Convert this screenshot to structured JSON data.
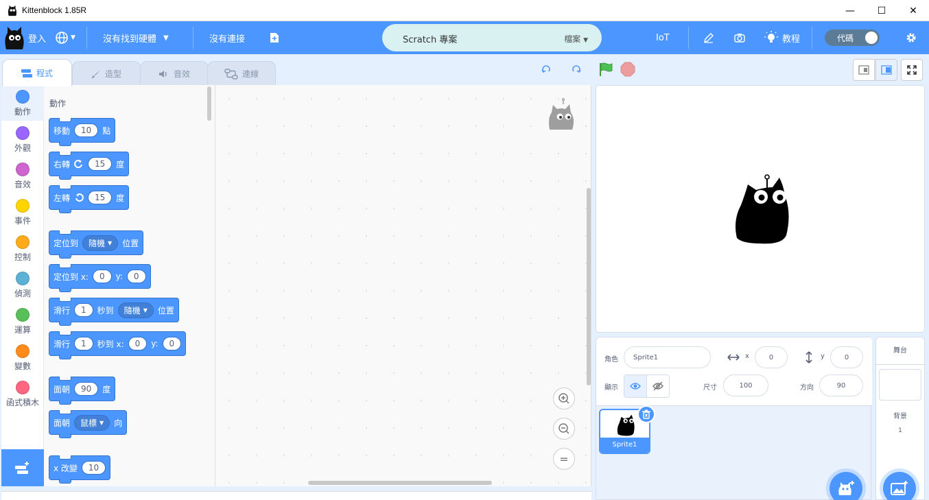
{
  "window": {
    "title": "Kittenblock 1.85R",
    "minimize": "—",
    "maximize": "☐",
    "close": "✕"
  },
  "menubar": {
    "login": "登入",
    "hardware": "沒有找到硬體",
    "connection": "沒有連接",
    "project_title": "Scratch 專案",
    "file_menu": "檔案",
    "iot": "IoT",
    "tutorials": "教程",
    "code_toggle": "代碼"
  },
  "tabs": [
    {
      "label": "程式"
    },
    {
      "label": "造型"
    },
    {
      "label": "音效"
    },
    {
      "label": "連線"
    }
  ],
  "categories": [
    {
      "label": "動作",
      "color": "#4c97ff"
    },
    {
      "label": "外觀",
      "color": "#9966ff"
    },
    {
      "label": "音效",
      "color": "#cf63cf"
    },
    {
      "label": "事件",
      "color": "#ffd500"
    },
    {
      "label": "控制",
      "color": "#ffab19"
    },
    {
      "label": "偵測",
      "color": "#5cb1d6"
    },
    {
      "label": "運算",
      "color": "#59c059"
    },
    {
      "label": "變數",
      "color": "#ff8c1a"
    },
    {
      "label": "函式積木",
      "color": "#ff6680"
    }
  ],
  "flyout": {
    "heading": "動作",
    "move": {
      "a": "移動",
      "v": "10",
      "b": "點"
    },
    "turn_right": {
      "a": "右轉",
      "v": "15",
      "b": "度"
    },
    "turn_left": {
      "a": "左轉",
      "v": "15",
      "b": "度"
    },
    "goto": {
      "a": "定位到",
      "dd": "隨機",
      "b": "位置"
    },
    "goto_xy": {
      "a": "定位到 x:",
      "x": "0",
      "ylab": "y:",
      "y": "0"
    },
    "glide": {
      "a": "滑行",
      "v": "1",
      "b": "秒到",
      "dd": "隨機",
      "c": "位置"
    },
    "glide_xy": {
      "a": "滑行",
      "v": "1",
      "b": "秒到 x:",
      "x": "0",
      "ylab": "y:",
      "y": "0"
    },
    "point_dir": {
      "a": "面朝",
      "v": "90",
      "b": "度"
    },
    "point_to": {
      "a": "面朝",
      "dd": "鼠標",
      "b": "向"
    },
    "change_x": {
      "a": "x 改變",
      "v": "10"
    }
  },
  "zoom": {
    "in": "+",
    "out": "−",
    "reset": "="
  },
  "sprite_info": {
    "sprite_label": "角色",
    "sprite_name": "Sprite1",
    "x_label": "x",
    "x": "0",
    "y_label": "y",
    "y": "0",
    "show_label": "顯示",
    "size_label": "尺寸",
    "size": "100",
    "direction_label": "方向",
    "direction": "90"
  },
  "sprites": [
    {
      "name": "Sprite1"
    }
  ],
  "stage_panel": {
    "title": "舞台",
    "backdrops_label": "背景",
    "backdrops_count": "1"
  }
}
